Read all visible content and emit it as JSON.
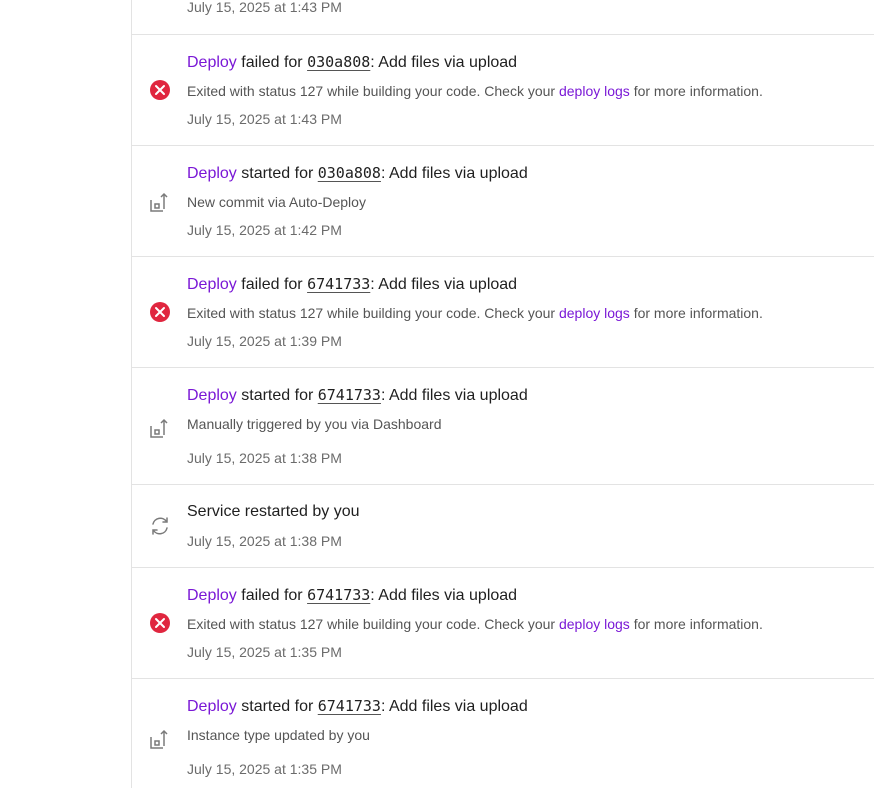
{
  "colors": {
    "accent": "#7a18d6",
    "error": "#e0263f",
    "text": "#1f1f1f",
    "muted": "#6b6b6b",
    "divider": "#e3e3e3"
  },
  "top_timestamp": "July 15, 2025 at 1:43 PM",
  "events": [
    {
      "icon": "error-icon",
      "deploy_word": "Deploy",
      "verb": " failed for ",
      "commit": "030a808",
      "message": ": Add files via upload",
      "desc_pre": "Exited with status 127 while building your code. Check your ",
      "desc_link": "deploy logs",
      "desc_post": " for more information.",
      "timestamp": "July 15, 2025 at 1:43 PM"
    },
    {
      "icon": "deploy-icon",
      "deploy_word": "Deploy",
      "verb": " started for ",
      "commit": "030a808",
      "message": ": Add files via upload",
      "desc": "New commit via Auto-Deploy",
      "timestamp": "July 15, 2025 at 1:42 PM"
    },
    {
      "icon": "error-icon",
      "deploy_word": "Deploy",
      "verb": " failed for ",
      "commit": "6741733",
      "message": ": Add files via upload",
      "desc_pre": "Exited with status 127 while building your code. Check your ",
      "desc_link": "deploy logs",
      "desc_post": " for more information.",
      "timestamp": "July 15, 2025 at 1:39 PM"
    },
    {
      "icon": "deploy-icon",
      "deploy_word": "Deploy",
      "verb": " started for ",
      "commit": "6741733",
      "message": ": Add files via upload",
      "desc": "Manually triggered by you via Dashboard",
      "timestamp": "July 15, 2025 at 1:38 PM"
    },
    {
      "icon": "restart-icon",
      "title": "Service restarted by you",
      "timestamp": "July 15, 2025 at 1:38 PM"
    },
    {
      "icon": "error-icon",
      "deploy_word": "Deploy",
      "verb": " failed for ",
      "commit": "6741733",
      "message": ": Add files via upload",
      "desc_pre": "Exited with status 127 while building your code. Check your ",
      "desc_link": "deploy logs",
      "desc_post": " for more information.",
      "timestamp": "July 15, 2025 at 1:35 PM"
    },
    {
      "icon": "deploy-icon",
      "deploy_word": "Deploy",
      "verb": " started for ",
      "commit": "6741733",
      "message": ": Add files via upload",
      "desc": "Instance type updated by you",
      "timestamp": "July 15, 2025 at 1:35 PM"
    }
  ]
}
